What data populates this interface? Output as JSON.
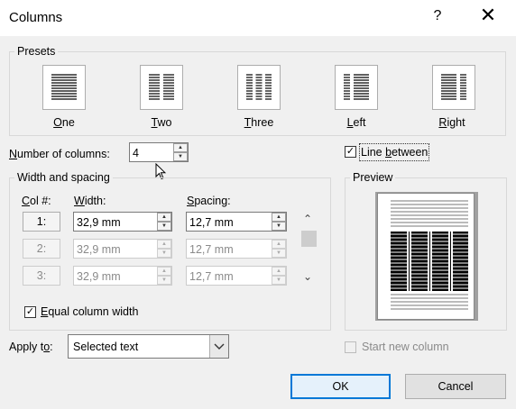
{
  "window": {
    "title": "Columns",
    "help": "?",
    "close": "✕"
  },
  "presets": {
    "legend": "Presets",
    "items": [
      {
        "label": "One",
        "underline": "O",
        "rest": "ne"
      },
      {
        "label": "Two",
        "underline": "T",
        "rest": "wo"
      },
      {
        "label": "Three",
        "underline": "T",
        "rest": "hree"
      },
      {
        "label": "Left",
        "underline": "L",
        "rest": "eft"
      },
      {
        "label": "Right",
        "underline": "R",
        "rest": "ight"
      }
    ]
  },
  "num_columns": {
    "label_u": "N",
    "label_rest": "umber of columns:",
    "value": "4"
  },
  "line_between": {
    "pre": "Line ",
    "u": "b",
    "post": "etween",
    "checked": "✓"
  },
  "width_spacing": {
    "legend": "Width and spacing",
    "col_header_u": "C",
    "col_header_rest": "ol #:",
    "width_header_u": "W",
    "width_header_rest": "idth:",
    "spacing_header_u": "S",
    "spacing_header_rest": "pacing:",
    "rows": [
      {
        "col": "1:",
        "width": "32,9 mm",
        "spacing": "12,7 mm",
        "enabled": true
      },
      {
        "col": "2:",
        "width": "32,9 mm",
        "spacing": "12,7 mm",
        "enabled": false
      },
      {
        "col": "3:",
        "width": "32,9 mm",
        "spacing": "12,7 mm",
        "enabled": false
      }
    ]
  },
  "equal_width": {
    "u": "E",
    "rest": "qual column width",
    "checked": "✓"
  },
  "preview": {
    "legend": "Preview"
  },
  "apply_to": {
    "label_pre": "Apply t",
    "label_u": "o",
    "label_post": ":",
    "value": "Selected text"
  },
  "start_new_column": {
    "label": "Start new column"
  },
  "buttons": {
    "ok": "OK",
    "cancel": "Cancel"
  }
}
